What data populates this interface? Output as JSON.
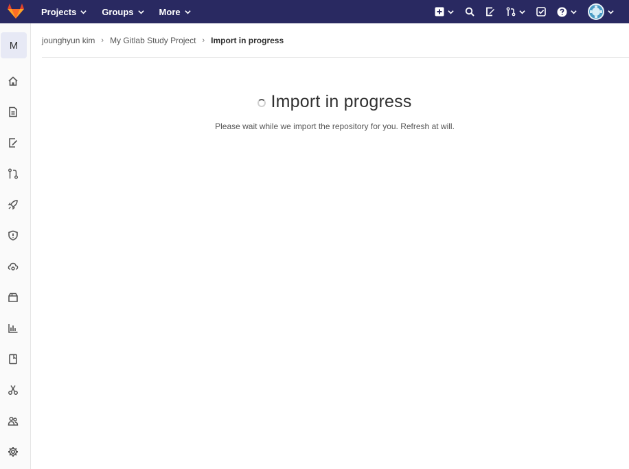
{
  "navbar": {
    "menu": [
      {
        "label": "Projects"
      },
      {
        "label": "Groups"
      },
      {
        "label": "More"
      }
    ],
    "colors": {
      "background": "#292961",
      "logo": "#e2432a"
    }
  },
  "sidebar": {
    "project_letter": "M",
    "items": [
      {
        "icon": "home-icon"
      },
      {
        "icon": "repository-icon"
      },
      {
        "icon": "issues-icon"
      },
      {
        "icon": "merge-request-icon"
      },
      {
        "icon": "rocket-icon"
      },
      {
        "icon": "shield-icon"
      },
      {
        "icon": "cloud-icon"
      },
      {
        "icon": "package-icon"
      },
      {
        "icon": "analytics-icon"
      },
      {
        "icon": "wiki-icon"
      },
      {
        "icon": "snippets-icon"
      },
      {
        "icon": "members-icon"
      },
      {
        "icon": "settings-icon"
      }
    ]
  },
  "breadcrumb": {
    "items": [
      "jounghyun kim",
      "My Gitlab Study Project"
    ],
    "current": "Import in progress"
  },
  "main": {
    "title": "Import in progress",
    "subtitle": "Please wait while we import the repository for you. Refresh at will."
  }
}
